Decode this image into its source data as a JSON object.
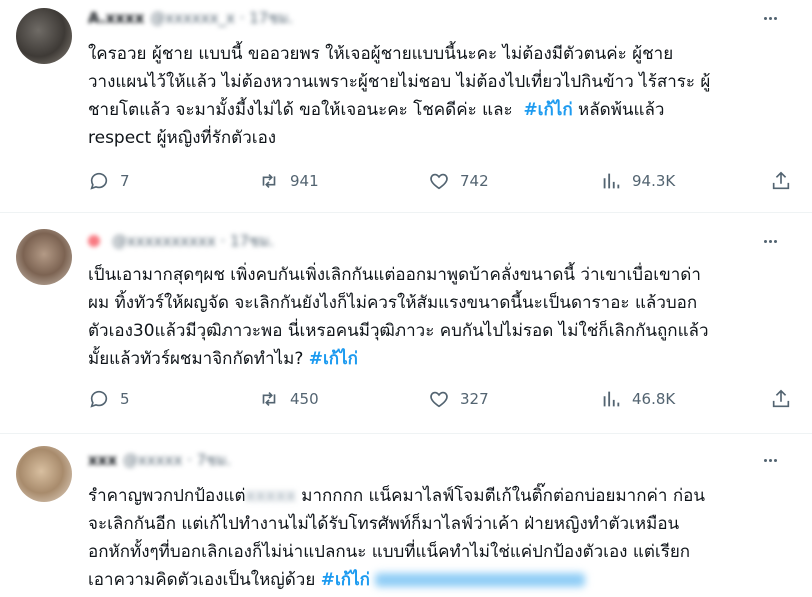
{
  "tweets": [
    {
      "name": "A.xxxx",
      "handle": "@xxxxxx_x · 17ชม.",
      "text_before": "ใครอวย ผู้ชาย แบบนี้ ขออวยพร ให้เจอผู้ชายแบบนี้นะคะ ไม่ต้องมีตัวตนค่ะ ผู้ชาย\nวางแผนไว้ให้แล้ว ไม่ต้องหวานเพราะผู้ชายไม่ชอบ ไม่ต้องไปเที่ยวไปกินข้าว ไร้สาระ ผู้\nชายโตแล้ว จะมามั้งมี้งไม่ได้ ขอให้เจอนะคะ โชคดีค่ะ และ  ",
      "hashtag": "#เก้ไก่",
      "text_after": " หลัดพ้นแล้ว\nrespect ผู้หญิงที่รักตัวเอง",
      "replies": "7",
      "retweets": "941",
      "likes": "742",
      "views": "94.3K"
    },
    {
      "name": "",
      "handle": "@xxxxxxxxxx · 17ชม.",
      "text_before": "เป็นเอามากสุดๆผช เพิ่งคบกันเพิ่งเลิกกันแต่ออกมาพูดบ้าคลั่งขนาดนี้ ว่าเขาเบื่อเขาด่า\nผม ทิ้งทัวร์ให้ผญจัด จะเลิกกันยังไงก็ไม่ควรให้สัมแรงขนาดนี้นะเป็นดาราอะ แล้วบอก\nตัวเอง30แล้วมีวุฒิภาวะพอ นี่เหรอคนมีวุฒิภาวะ คบกันไปไม่รอด ไม่ใช่ก็เลิกกันถูกแล้ว\nมั้ยแล้วทัวร์ผชมาจิกกัดทำไม? ",
      "hashtag": "#เก้ไก่",
      "text_after": "",
      "replies": "5",
      "retweets": "450",
      "likes": "327",
      "views": "46.8K"
    },
    {
      "name": "xxx",
      "handle": "@xxxxx · 7ชม.",
      "text_line1_before": "รำคาญพวกปกป้องแต่",
      "text_blurred_word": "xxxxx",
      "text_line1_after": " มากกกก แน็คมาไลฟ์โจมตีเก้ในติ๊กต่อกบ่อยมากค่า ก่อน\nจะเลิกกันอีก แต่เก้ไปทำงานไม่ได้รับโทรศัพท์ก็มาไลฟ์ว่าเค้า ฝ่ายหญิงทำตัวเหมือน\nอกหักทั้งๆที่บอกเลิกเองก็ไม่น่าแปลกนะ แบบที่แน็คทำไม่ใช่แค่ปกป้องตัวเอง แต่เรียก\nเอาความคิดตัวเองเป็นใหญ่ด้วย ",
      "hashtag": "#เก้ไก่"
    }
  ],
  "icons": {
    "reply": "reply-icon",
    "retweet": "retweet-icon",
    "like": "heart-icon",
    "views": "views-icon",
    "share": "share-icon",
    "more": "more-icon"
  },
  "colors": {
    "hashtag": "#1d9bf0",
    "secondary": "#536471",
    "divider": "#eff3f4"
  }
}
